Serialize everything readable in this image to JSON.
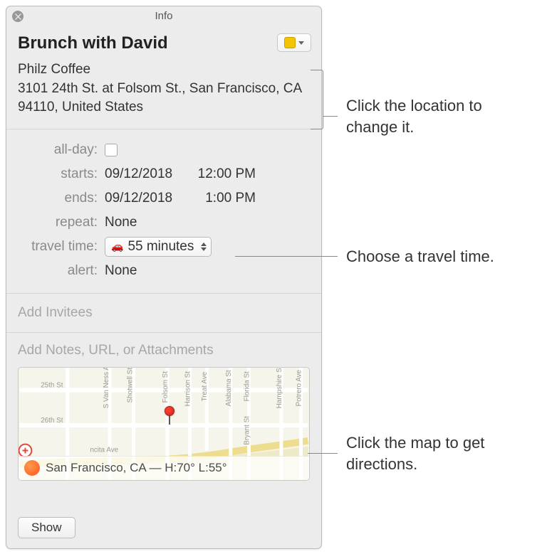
{
  "window": {
    "title": "Info"
  },
  "event": {
    "title": "Brunch with David",
    "location_name": "Philz Coffee",
    "location_address": "3101 24th St. at Folsom St., San Francisco, CA 94110, United States"
  },
  "fields": {
    "allday_label": "all-day:",
    "starts_label": "starts:",
    "ends_label": "ends:",
    "repeat_label": "repeat:",
    "travel_label": "travel time:",
    "alert_label": "alert:",
    "starts_date": "09/12/2018",
    "starts_time": "12:00 PM",
    "ends_date": "09/12/2018",
    "ends_time": "1:00 PM",
    "repeat_value": "None",
    "travel_value": "55 minutes",
    "alert_value": "None"
  },
  "placeholders": {
    "invitees": "Add Invitees",
    "notes": "Add Notes, URL, or Attachments"
  },
  "map": {
    "caption": "San Francisco, CA — H:70° L:55°",
    "streets": [
      "25th St",
      "26th St",
      "S Van Ness Ave",
      "Shotwell St",
      "Folsom St",
      "Harrison St",
      "Treat Ave",
      "Alabama St",
      "Florida St",
      "Bryant St",
      "Hampshire St",
      "Potrero Ave",
      "ncita Ave"
    ]
  },
  "buttons": {
    "show": "Show"
  },
  "callouts": {
    "location": "Click the location to change it.",
    "travel": "Choose a travel time.",
    "map": "Click the map to get directions."
  },
  "colors": {
    "calendar": "#f3c400"
  }
}
